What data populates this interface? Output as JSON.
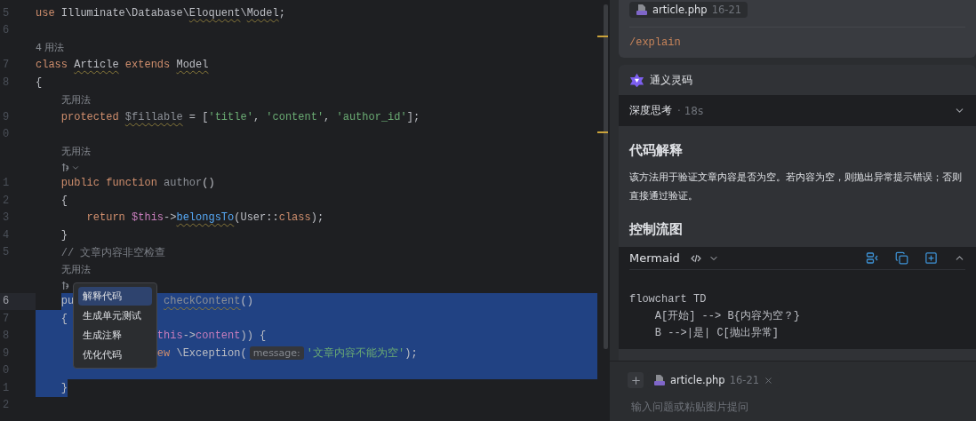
{
  "editor": {
    "lines": [
      {
        "kind": "code",
        "number": "5",
        "selected": false,
        "current": false,
        "fragments": [
          {
            "kind": "code",
            "tokens": [
              {
                "text": "use ",
                "color": "#cf8e6d"
              },
              {
                "text": "Illuminate\\Database\\"
              },
              {
                "text": "Eloquent",
                "warn": true
              },
              {
                "text": "\\"
              },
              {
                "text": "Model",
                "warn": true
              },
              {
                "text": ";"
              }
            ]
          }
        ]
      },
      {
        "kind": "code",
        "number": "6",
        "selected": false,
        "current": false
      },
      {
        "kind": "hint",
        "text": "4 用法",
        "selected": false
      },
      {
        "kind": "code",
        "number": "7",
        "selected": false,
        "current": false,
        "fragments": [
          {
            "kind": "code",
            "tokens": [
              {
                "text": "class ",
                "color": "#cf8e6d"
              },
              {
                "text": "Article",
                "warn": true
              },
              {
                "text": " extends ",
                "color": "#cf8e6d"
              },
              {
                "text": "Model",
                "warn": true
              }
            ]
          }
        ]
      },
      {
        "kind": "code",
        "number": "8",
        "selected": false,
        "current": false,
        "fragments": [
          {
            "kind": "code",
            "tokens": [
              {
                "text": "{"
              }
            ]
          }
        ]
      },
      {
        "kind": "hint",
        "text": "    无用法",
        "selected": false
      },
      {
        "kind": "code",
        "number": "9",
        "selected": false,
        "current": false,
        "fragments": [
          {
            "kind": "code",
            "tokens": [
              {
                "text": "    protected ",
                "color": "#cf8e6d"
              },
              {
                "text": "$fillable",
                "color": "#8c9097",
                "warn": true
              },
              {
                "text": " = ["
              },
              {
                "text": "'title'",
                "color": "#6aab73"
              },
              {
                "text": ", "
              },
              {
                "text": "'content'",
                "color": "#6aab73"
              },
              {
                "text": ", "
              },
              {
                "text": "'author_id'",
                "color": "#6aab73"
              },
              {
                "text": "];"
              }
            ]
          }
        ]
      },
      {
        "kind": "code",
        "number": "0",
        "selected": false,
        "current": false
      },
      {
        "kind": "hint",
        "text": "    无用法",
        "selected": false
      },
      {
        "kind": "ai-hint",
        "chevron": true,
        "selected": false
      },
      {
        "kind": "code",
        "number": "1",
        "selected": false,
        "current": false,
        "fragments": [
          {
            "kind": "code",
            "tokens": [
              {
                "text": "    public function ",
                "color": "#cf8e6d"
              },
              {
                "text": "author",
                "color": "#8c9097"
              },
              {
                "text": "()"
              }
            ]
          }
        ]
      },
      {
        "kind": "code",
        "number": "2",
        "selected": false,
        "current": false,
        "fragments": [
          {
            "kind": "code",
            "tokens": [
              {
                "text": "    {"
              }
            ]
          }
        ]
      },
      {
        "kind": "code",
        "number": "3",
        "selected": false,
        "current": false,
        "fragments": [
          {
            "kind": "code",
            "tokens": [
              {
                "text": "        return ",
                "color": "#cf8e6d"
              },
              {
                "text": "$this",
                "color": "#c77dbb"
              },
              {
                "text": "->"
              },
              {
                "text": "belongsTo",
                "color": "#56a8f5",
                "warn": true
              },
              {
                "text": "(User::"
              },
              {
                "text": "class",
                "color": "#cf8e6d"
              },
              {
                "text": ");"
              }
            ]
          }
        ]
      },
      {
        "kind": "code",
        "number": "4",
        "selected": false,
        "current": false,
        "fragments": [
          {
            "kind": "code",
            "tokens": [
              {
                "text": "    }"
              }
            ]
          }
        ]
      },
      {
        "kind": "code",
        "number": "5",
        "selected": false,
        "current": false,
        "fragments": [
          {
            "kind": "code",
            "tokens": [
              {
                "text": "    // 文章内容非空检查",
                "color": "#7a7e85"
              }
            ]
          }
        ]
      },
      {
        "kind": "hint",
        "text": "    无用法",
        "selected": false
      },
      {
        "kind": "ai-hint",
        "selected": false
      },
      {
        "kind": "code",
        "number": "6",
        "selected": true,
        "from_text": true,
        "current": true,
        "fragments": [
          {
            "kind": "code",
            "tokens": [
              {
                "text": "    pu"
              }
            ]
          },
          {
            "kind": "code",
            "tokens": [
              {
                "text": "              checkContent",
                "color": "#8c9097",
                "warn": true
              },
              {
                "text": "()"
              }
            ]
          }
        ]
      },
      {
        "kind": "code",
        "number": "7",
        "selected": true,
        "current": false,
        "fragments": [
          {
            "kind": "code",
            "tokens": [
              {
                "text": "    {"
              }
            ]
          }
        ]
      },
      {
        "kind": "code",
        "number": "8",
        "selected": true,
        "current": false,
        "fragments": [
          {
            "kind": "code",
            "tokens": [
              {
                "text": "                   this",
                "color": "#c77dbb"
              },
              {
                "text": "->"
              },
              {
                "text": "content",
                "color": "#c77dbb"
              },
              {
                "text": ")) {"
              }
            ]
          }
        ]
      },
      {
        "kind": "code",
        "number": "9",
        "selected": true,
        "current": false,
        "fragments": [
          {
            "kind": "code",
            "tokens": [
              {
                "text": "                   ew",
                "color": "#cf8e6d"
              },
              {
                "text": " \\Exception("
              }
            ]
          },
          {
            "kind": "inlay",
            "text": "message:"
          },
          {
            "kind": "code",
            "tokens": [
              {
                "text": "'文章内容不能为空'",
                "color": "#6aab73"
              },
              {
                "text": ");"
              }
            ]
          }
        ]
      },
      {
        "kind": "code",
        "number": "0",
        "selected": true,
        "current": false
      },
      {
        "kind": "code",
        "number": "1",
        "selected": true,
        "to_text": true,
        "current": false,
        "fragments": [
          {
            "kind": "code",
            "tokens": [
              {
                "text": "    }"
              }
            ]
          }
        ]
      },
      {
        "kind": "code",
        "number": "2",
        "selected": false,
        "current": false
      }
    ],
    "context_menu": [
      {
        "label": "解释代码",
        "selected": true
      },
      {
        "label": "生成单元测试",
        "selected": false
      },
      {
        "label": "生成注释",
        "selected": false
      },
      {
        "label": "优化代码",
        "selected": false
      }
    ]
  },
  "chat": {
    "user_message": {
      "file_chip": {
        "name": "article.php",
        "range": "16-21"
      },
      "command": "/explain"
    },
    "assistant": {
      "name": "通义灵码",
      "thinking": {
        "label": "深度思考",
        "meta": "· 18s",
        "expanded": false
      },
      "heading_1": "代码解释",
      "paragraph": "该方法用于验证文章内容是否为空。若内容为空，则抛出异常提示错误；否则直接通过验证。",
      "heading_2": "控制流图",
      "code_block": {
        "language": "Mermaid",
        "expanded": true,
        "lines": [
          "flowchart TD",
          "    A[开始] --> B{内容为空？}",
          "    B -->|是| C[抛出异常]"
        ]
      }
    },
    "input": {
      "file_chip": {
        "name": "article.php",
        "range": "16-21"
      },
      "placeholder": "输入问题或粘贴图片提问"
    }
  }
}
